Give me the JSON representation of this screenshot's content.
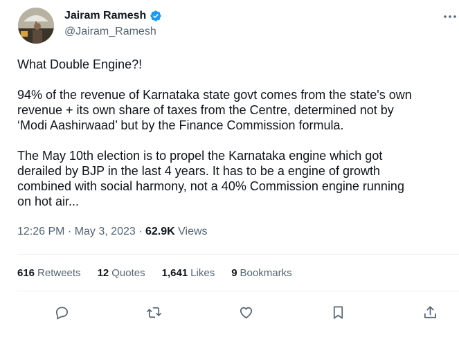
{
  "author": {
    "name": "Jairam Ramesh",
    "handle": "@Jairam_Ramesh"
  },
  "tweet": {
    "paragraphs": [
      [
        "What Double Engine?!"
      ],
      [
        "94% of the revenue of Karnataka state govt comes from the state's own",
        "revenue + its own share of taxes from the Centre, determined not by",
        "‘Modi Aashirwaad’ but by the Finance Commission formula."
      ],
      [
        "The May 10th election is to propel the Karnataka engine which got",
        "derailed by BJP in the last 4 years. It has to be a engine of growth",
        "combined with social harmony, not a 40% Commission engine running",
        "on hot air..."
      ]
    ]
  },
  "meta": {
    "time": "12:26 PM",
    "separator": " · ",
    "date": "May 3, 2023",
    "views_count": "62.9K",
    "views_label": "Views"
  },
  "stats": [
    {
      "count": "616",
      "label": "Retweets"
    },
    {
      "count": "12",
      "label": "Quotes"
    },
    {
      "count": "1,641",
      "label": "Likes"
    },
    {
      "count": "9",
      "label": "Bookmarks"
    }
  ],
  "actions": [
    "reply-icon",
    "retweet-icon",
    "like-icon",
    "bookmark-icon",
    "share-icon"
  ],
  "colors": {
    "text": "#0f1419",
    "secondary": "#536471",
    "verified": "#1d9bf0",
    "divider": "#eff3f4"
  }
}
